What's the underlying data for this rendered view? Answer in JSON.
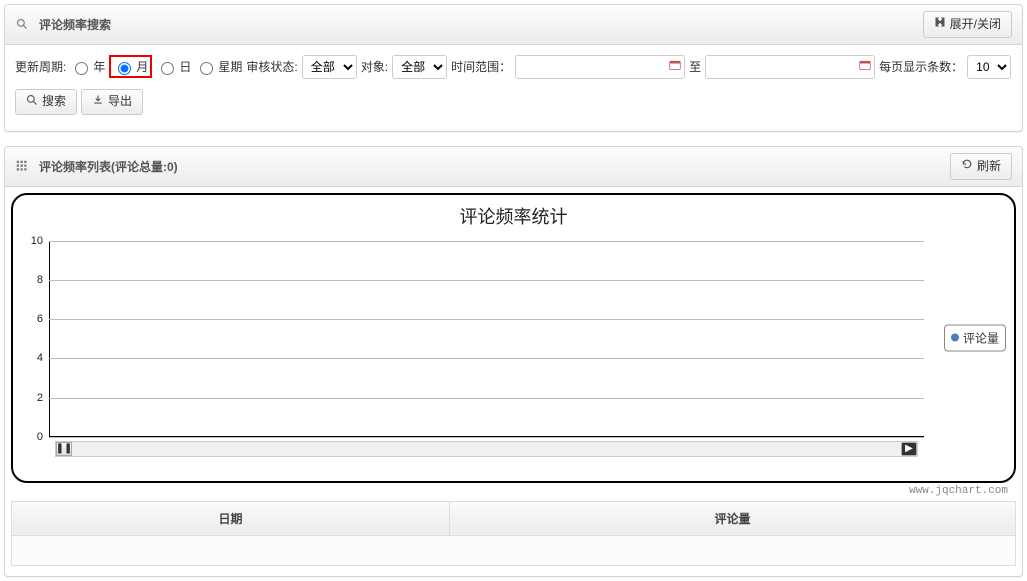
{
  "search_panel": {
    "title": "评论频率搜索",
    "toggle_label": "展开/关闭",
    "update_cycle_label": "更新周期:",
    "radios": {
      "year": "年",
      "month": "月",
      "day": "日",
      "week": "星期"
    },
    "audit_label": "审核状态:",
    "audit_value": "全部",
    "target_label": "对象:",
    "target_value": "全部",
    "time_range_label": "时间范围：",
    "to_label": "至",
    "per_page_label": "每页显示条数：",
    "per_page_value": "10",
    "search_btn": "搜索",
    "export_btn": "导出"
  },
  "list_panel": {
    "title": "评论频率列表(评论总量:0)",
    "refresh_btn": "刷新",
    "watermark": "www.jqchart.com",
    "table_headers": {
      "date": "日期",
      "count": "评论量"
    }
  },
  "chart_data": {
    "type": "line",
    "title": "评论频率统计",
    "xlabel": "",
    "ylabel": "",
    "ylim": [
      0,
      10
    ],
    "y_ticks": [
      0,
      2,
      4,
      6,
      8,
      10
    ],
    "categories": [],
    "series": [
      {
        "name": "评论量",
        "values": []
      }
    ],
    "legend_position": "right"
  }
}
